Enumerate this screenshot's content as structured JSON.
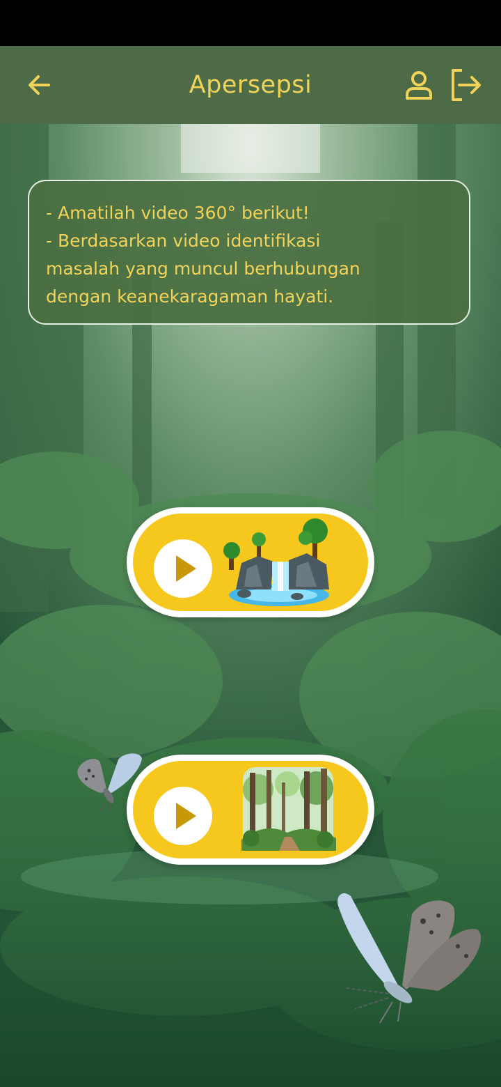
{
  "app_bar": {
    "title": "Apersepsi",
    "back_icon": "arrow-left-icon",
    "profile_icon": "user-icon",
    "logout_icon": "logout-icon",
    "accent_color": "#f2d35a",
    "background_color": "#4e6b47"
  },
  "instructions": {
    "lines": [
      "- Amatilah video 360° berikut!",
      "- Berdasarkan video identifikasi",
      "masalah yang muncul berhubungan",
      "dengan keanekaragaman hayati."
    ]
  },
  "videos": [
    {
      "icon": "play-icon",
      "thumbnail": "waterfall-illustration"
    },
    {
      "icon": "play-icon",
      "thumbnail": "forest-illustration"
    }
  ],
  "decorations": [
    "butterfly-illustration",
    "butterfly-illustration"
  ]
}
